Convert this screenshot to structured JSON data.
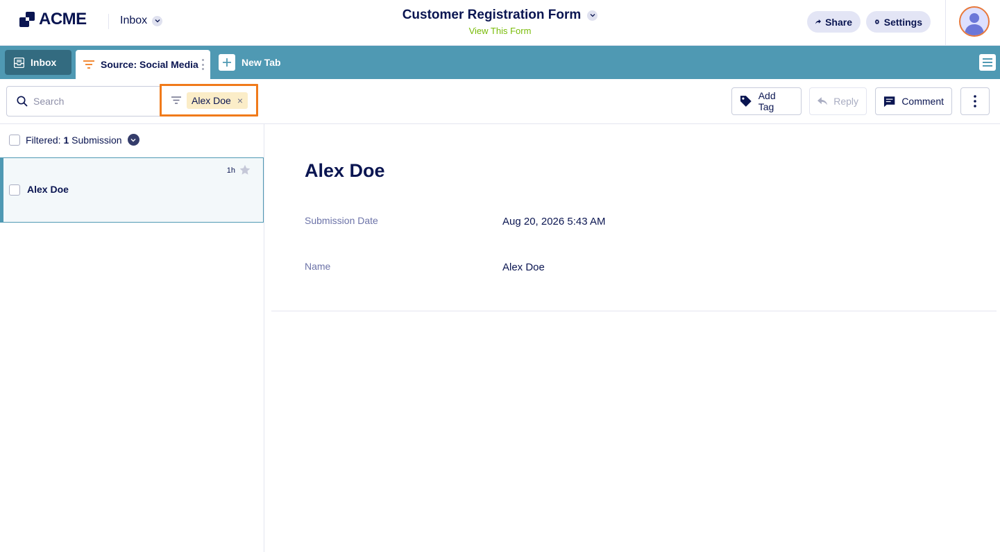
{
  "header": {
    "logo_text": "ACME",
    "inbox_label": "Inbox",
    "form_title": "Customer Registration Form",
    "form_link": "View This Form",
    "share_label": "Share",
    "settings_label": "Settings",
    "avatar_accent": "#e8783a"
  },
  "tabs": {
    "inbox_label": "Inbox",
    "source_label": "Source: Social Media",
    "new_tab_label": "New Tab",
    "bar_color": "#4f99b3"
  },
  "toolbar": {
    "search_placeholder": "Search",
    "filter_chip": "Alex Doe",
    "chip_remove": "×",
    "add_tag_label": "Add Tag",
    "reply_label": "Reply",
    "comment_label": "Comment",
    "highlight_color": "#f07a1a"
  },
  "list": {
    "filtered_prefix": "Filtered:",
    "filtered_count": "1",
    "filtered_suffix": "Submission",
    "items": [
      {
        "name": "Alex Doe",
        "time": "1h"
      }
    ]
  },
  "detail": {
    "title": "Alex Doe",
    "fields": [
      {
        "label": "Submission Date",
        "value": "Aug 20, 2026 5:43 AM"
      },
      {
        "label": "Name",
        "value": "Alex Doe"
      }
    ]
  }
}
